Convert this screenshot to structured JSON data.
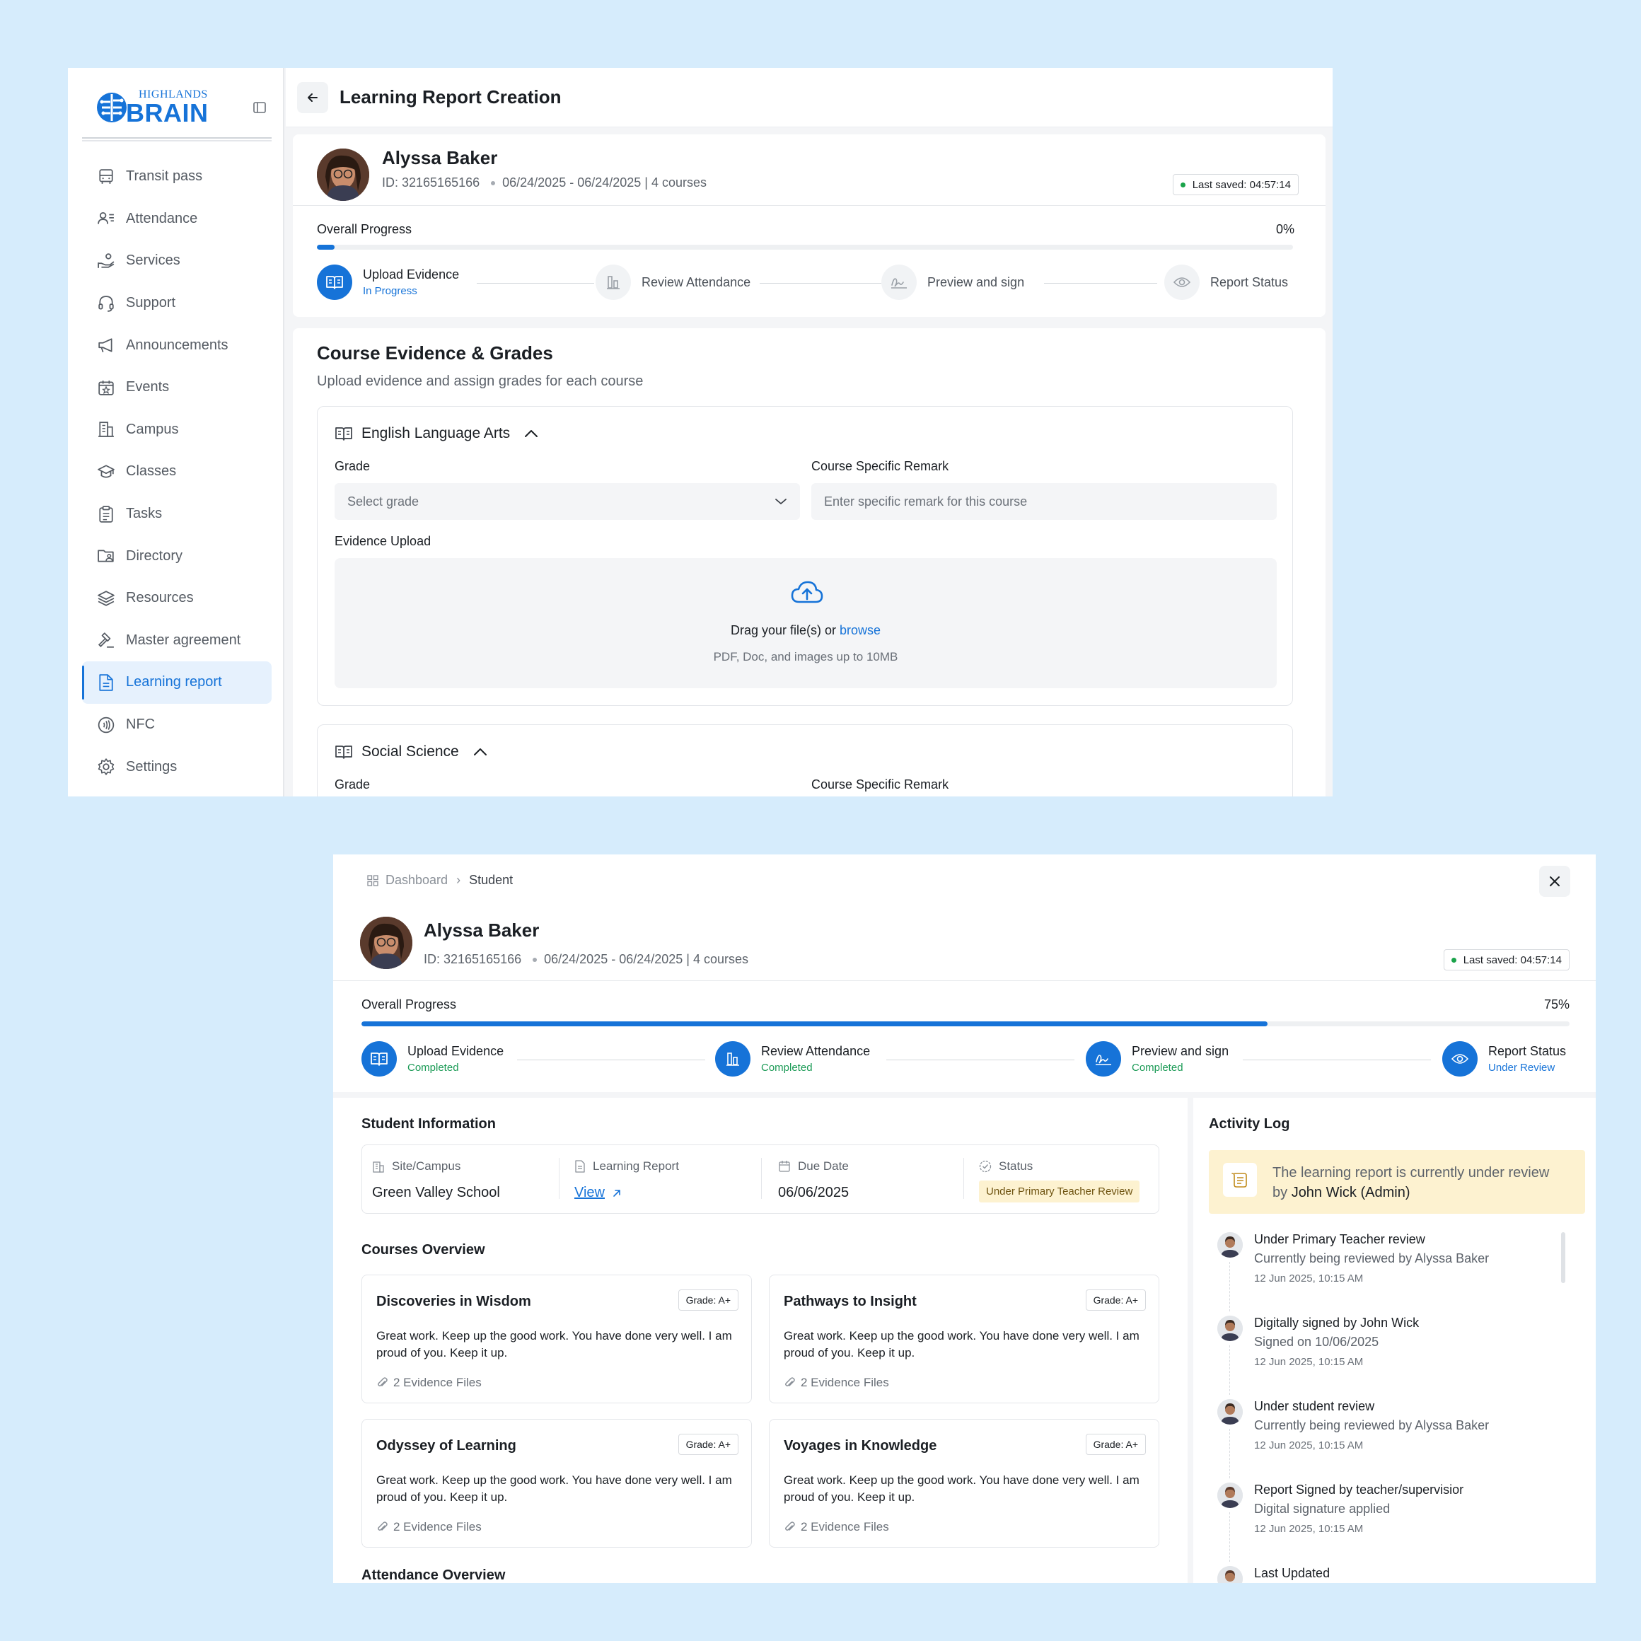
{
  "screen1": {
    "brand": {
      "small": "HIGHLANDS",
      "big": "BRAIN"
    },
    "nav": [
      {
        "label": "Transit pass",
        "icon": "bus-icon"
      },
      {
        "label": "Attendance",
        "icon": "user-list-icon"
      },
      {
        "label": "Services",
        "icon": "hand-coins-icon"
      },
      {
        "label": "Support",
        "icon": "headset-icon"
      },
      {
        "label": "Announcements",
        "icon": "megaphone-icon"
      },
      {
        "label": "Events",
        "icon": "calendar-star-icon"
      },
      {
        "label": "Campus",
        "icon": "building-icon"
      },
      {
        "label": "Classes",
        "icon": "graduation-cap-icon"
      },
      {
        "label": "Tasks",
        "icon": "clipboard-icon"
      },
      {
        "label": "Directory",
        "icon": "folder-user-icon"
      },
      {
        "label": "Resources",
        "icon": "layers-icon"
      },
      {
        "label": "Master agreement",
        "icon": "gavel-icon"
      },
      {
        "label": "Learning report",
        "icon": "document-icon",
        "active": true
      },
      {
        "label": "NFC",
        "icon": "nfc-icon"
      },
      {
        "label": "Settings",
        "icon": "gear-icon"
      }
    ],
    "page_title": "Learning Report Creation",
    "student": {
      "name": "Alyssa Baker",
      "id": "ID: 32165165166",
      "dates": "06/24/2025 - 06/24/2025 | 4 courses",
      "last_saved": "Last saved: 04:57:14"
    },
    "progress": {
      "label": "Overall Progress",
      "value_text": "0%",
      "fraction": 0.018
    },
    "steps": [
      {
        "name": "Upload Evidence",
        "status": "In Progress"
      },
      {
        "name": "Review Attendance",
        "status": ""
      },
      {
        "name": "Preview and sign",
        "status": ""
      },
      {
        "name": "Report Status",
        "status": ""
      }
    ],
    "section": {
      "title": "Course Evidence & Grades",
      "subtitle": "Upload evidence and assign grades for each course"
    },
    "courses": [
      {
        "name": "English Language Arts",
        "grade_label": "Grade",
        "grade_placeholder": "Select grade",
        "remark_label": "Course Specific Remark",
        "remark_placeholder": "Enter specific remark for this course",
        "evidence_label": "Evidence Upload",
        "drop_text": "Drag your file(s) or ",
        "drop_link": "browse",
        "drop_hint": "PDF, Doc, and images up to 10MB"
      },
      {
        "name": "Social Science",
        "grade_label": "Grade",
        "remark_label": "Course Specific Remark"
      }
    ]
  },
  "screen2": {
    "breadcrumb": {
      "root": "Dashboard",
      "current": "Student"
    },
    "student": {
      "name": "Alyssa Baker",
      "id": "ID: 32165165166",
      "dates": "06/24/2025 - 06/24/2025 | 4 courses",
      "last_saved": "Last saved: 04:57:14"
    },
    "progress": {
      "label": "Overall Progress",
      "value_text": "75%",
      "fraction": 0.75
    },
    "steps": [
      {
        "name": "Upload Evidence",
        "status": "Completed"
      },
      {
        "name": "Review Attendance",
        "status": "Completed"
      },
      {
        "name": "Preview and sign",
        "status": "Completed"
      },
      {
        "name": "Report Status",
        "status": "Under Review"
      }
    ],
    "student_info": {
      "title": "Student Information",
      "site_label": "Site/Campus",
      "site_value": "Green Valley School",
      "report_label": "Learning Report",
      "report_link": "View",
      "due_label": "Due Date",
      "due_value": "06/06/2025",
      "status_label": "Status",
      "status_value": "Under Primary Teacher Review"
    },
    "courses_overview": {
      "title": "Courses Overview",
      "items": [
        {
          "title": "Discoveries in Wisdom",
          "grade": "Grade: A+",
          "desc": "Great work. Keep up the good work. You have done very well. I am proud of you. Keep it up.",
          "files": "2 Evidence Files"
        },
        {
          "title": "Pathways to Insight",
          "grade": "Grade: A+",
          "desc": "Great work. Keep up the good work. You have done very well. I am proud of you. Keep it up.",
          "files": "2 Evidence Files"
        },
        {
          "title": "Odyssey of Learning",
          "grade": "Grade: A+",
          "desc": "Great work. Keep up the good work. You have done very well. I am proud of you. Keep it up.",
          "files": "2 Evidence Files"
        },
        {
          "title": "Voyages in Knowledge",
          "grade": "Grade: A+",
          "desc": "Great work. Keep up the good work. You have done very well. I am proud of you. Keep it up.",
          "files": "2 Evidence Files"
        }
      ]
    },
    "attendance_title": "Attendance Overview",
    "activity": {
      "title": "Activity Log",
      "notice_text": "The learning report is currently under review by ",
      "notice_name": "John Wick (Admin)",
      "items": [
        {
          "title": "Under Primary Teacher review",
          "sub": "Currently being reviewed by Alyssa Baker",
          "time": "12 Jun 2025, 10:15 AM"
        },
        {
          "title": "Digitally signed by John Wick",
          "sub": "Signed on 10/06/2025",
          "time": "12 Jun 2025, 10:15 AM"
        },
        {
          "title": "Under student review",
          "sub": "Currently being reviewed by Alyssa Baker",
          "time": "12 Jun 2025, 10:15 AM"
        },
        {
          "title": "Report Signed by  teacher/supervisior",
          "sub": "Digital signature applied",
          "time": "12 Jun 2025, 10:15 AM"
        },
        {
          "title": "Last Updated",
          "sub": "",
          "time": ""
        }
      ]
    }
  }
}
